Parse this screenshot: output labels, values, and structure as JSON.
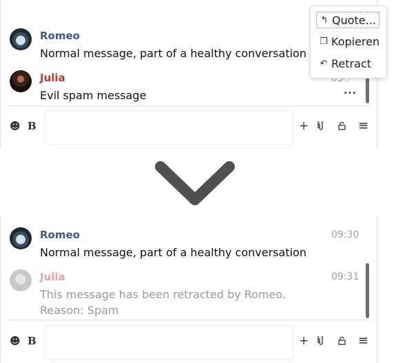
{
  "top": {
    "romeo": {
      "name": "Romeo",
      "text": "Normal message, part of a healthy conversation"
    },
    "julia": {
      "name": "Julia",
      "text": "Evil spam message",
      "time_partial": "09"
    },
    "context_menu": {
      "items": [
        {
          "label": "Quote...",
          "icon": "quote-icon"
        },
        {
          "label": "Kopieren",
          "icon": "copy-icon"
        },
        {
          "label": "Retract",
          "icon": "undo-icon"
        }
      ]
    },
    "more_button": "..."
  },
  "bottom": {
    "romeo": {
      "name": "Romeo",
      "time": "09:30",
      "text": "Normal message, part of a healthy conversation"
    },
    "julia": {
      "name": "Julia",
      "time": "09:31",
      "text": "This message has been retracted by Romeo. Reason: Spam"
    }
  },
  "toolbar": {
    "emoji_icon": "☻",
    "bold_label": "B",
    "add_icon": "+",
    "attach_icon": "attachment-icon",
    "lock_icon": "lock-icon",
    "menu_icon": "≡"
  },
  "colors": {
    "romeo": "#3a5a8c",
    "julia": "#c0392b",
    "retracted": "#9a9a9a",
    "chevron": "#505050"
  }
}
